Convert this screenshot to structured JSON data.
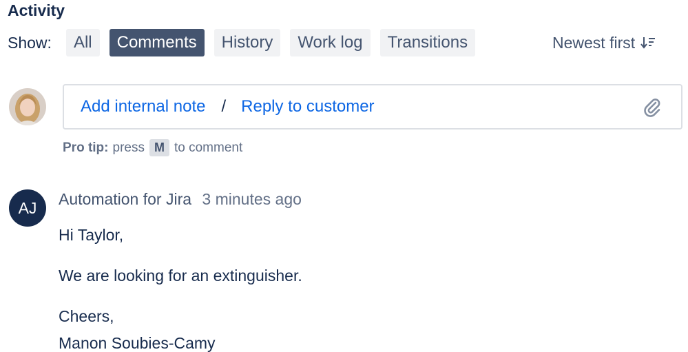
{
  "activity": {
    "title": "Activity",
    "show_label": "Show:",
    "filters": [
      {
        "label": "All",
        "active": false
      },
      {
        "label": "Comments",
        "active": true
      },
      {
        "label": "History",
        "active": false
      },
      {
        "label": "Work log",
        "active": false
      },
      {
        "label": "Transitions",
        "active": false
      }
    ],
    "sort_label": "Newest first",
    "sort_icon": "sort-descending-icon"
  },
  "composer": {
    "add_internal_note": "Add internal note",
    "separator": "/",
    "reply_to_customer": "Reply to customer",
    "attach_icon": "paperclip-icon",
    "pro_tip_bold": "Pro tip:",
    "pro_tip_press": "press",
    "pro_tip_key": "M",
    "pro_tip_suffix": "to comment"
  },
  "comment": {
    "avatar_initials": "AJ",
    "author": "Automation for Jira",
    "time": "3 minutes ago",
    "lines": [
      "Hi Taylor,",
      "We are looking for an extinguisher.",
      "Cheers,",
      "Manon Soubies-Camy"
    ]
  },
  "colors": {
    "text_primary": "#172b4d",
    "text_subtle": "#44546f",
    "link": "#0c66e4",
    "active_filter_bg": "#44546f",
    "filter_bg": "#f1f2f4",
    "avatar_bg": "#172b4d"
  }
}
